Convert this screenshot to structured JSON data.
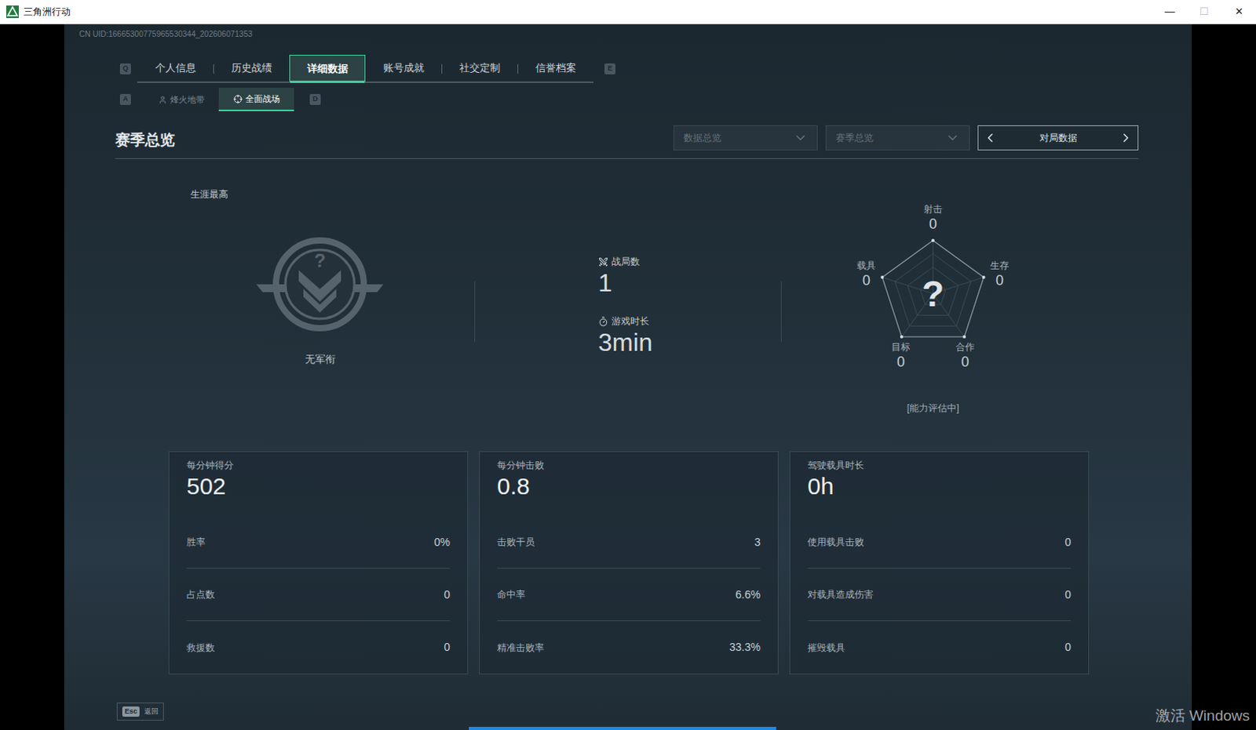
{
  "window": {
    "title": "三角洲行动",
    "controls": [
      "—",
      "☐",
      "✕"
    ]
  },
  "uid": "CN UID:16665300775965530344_202606071353",
  "tabs": {
    "prev_key": "Q",
    "next_key": "E",
    "items": [
      {
        "label": "个人信息",
        "selected": false
      },
      {
        "label": "历史战绩",
        "selected": false
      },
      {
        "label": "详细数据",
        "selected": true
      },
      {
        "label": "账号成就",
        "selected": false
      },
      {
        "label": "社交定制",
        "selected": false
      },
      {
        "label": "信誉档案",
        "selected": false
      }
    ]
  },
  "subtabs": {
    "prev_key": "A",
    "next_key": "D",
    "items": [
      {
        "label": "烽火地带",
        "selected": false
      },
      {
        "label": "全面战场",
        "selected": true
      }
    ]
  },
  "section": {
    "title": "赛季总览",
    "filters": [
      {
        "label": "数据总览"
      },
      {
        "label": "赛季总览"
      }
    ],
    "pager": {
      "label": "对局数据"
    }
  },
  "career": {
    "label": "生涯最高",
    "badge_symbol": "?",
    "rank": "无军衔"
  },
  "summary": [
    {
      "label": "战局数",
      "value": "1"
    },
    {
      "label": "游戏时长",
      "value": "3min"
    }
  ],
  "radar": {
    "center": "?",
    "status": "[能力评估中]",
    "axes": [
      {
        "label": "射击",
        "value": "0"
      },
      {
        "label": "生存",
        "value": "0"
      },
      {
        "label": "合作",
        "value": "0"
      },
      {
        "label": "目标",
        "value": "0"
      },
      {
        "label": "载具",
        "value": "0"
      }
    ]
  },
  "cards": [
    {
      "title": "每分钟得分",
      "value": "502",
      "rows": [
        {
          "label": "胜率",
          "value": "0%"
        },
        {
          "label": "占点数",
          "value": "0"
        },
        {
          "label": "救援数",
          "value": "0"
        }
      ]
    },
    {
      "title": "每分钟击败",
      "value": "0.8",
      "rows": [
        {
          "label": "击败干员",
          "value": "3"
        },
        {
          "label": "命中率",
          "value": "6.6%"
        },
        {
          "label": "精准击败率",
          "value": "33.3%"
        }
      ]
    },
    {
      "title": "驾驶载具时长",
      "value": "0h",
      "rows": [
        {
          "label": "使用载具击败",
          "value": "0"
        },
        {
          "label": "对载具造成伤害",
          "value": "0"
        },
        {
          "label": "摧毁载具",
          "value": "0"
        }
      ]
    }
  ],
  "footer": {
    "key": "Esc",
    "label": "返回"
  },
  "watermark": "激活 Windows"
}
